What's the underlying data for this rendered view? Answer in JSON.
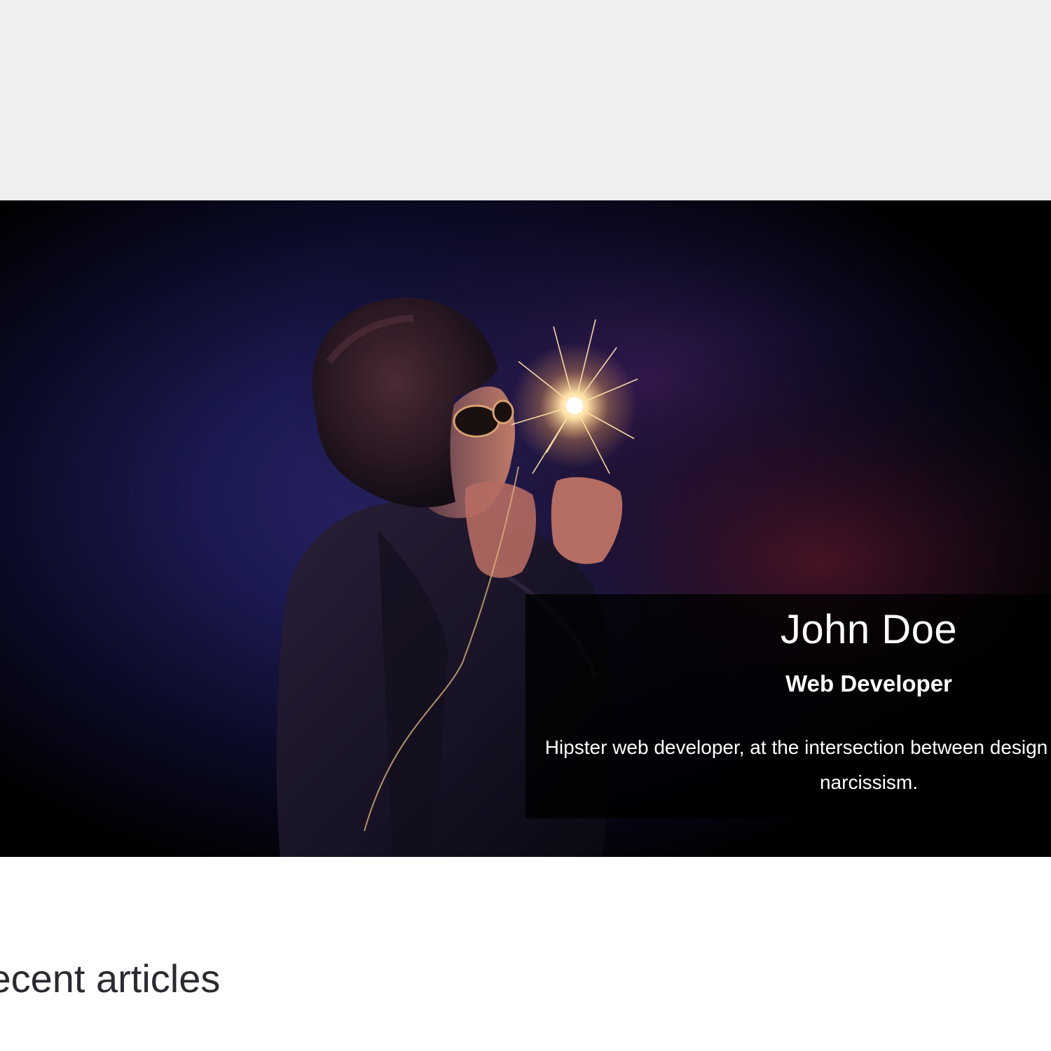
{
  "hero": {
    "image_description_icon": "portrait-sparkler-photo",
    "colors": {
      "backdrop_blue": "#1a1f5a",
      "backdrop_purple": "#3a1a4a",
      "backdrop_red": "#5a1620",
      "spark": "#ffe2a8"
    }
  },
  "profile": {
    "name": "John Doe",
    "role": "Web Developer",
    "bio": "Hipster web developer, at the intersection between design and overinflated narcissism."
  },
  "articles": {
    "heading": "Recent articles"
  },
  "colors": {
    "top_band": "#efefef",
    "card_background": "#000000",
    "heading_text": "#2a2a30"
  }
}
